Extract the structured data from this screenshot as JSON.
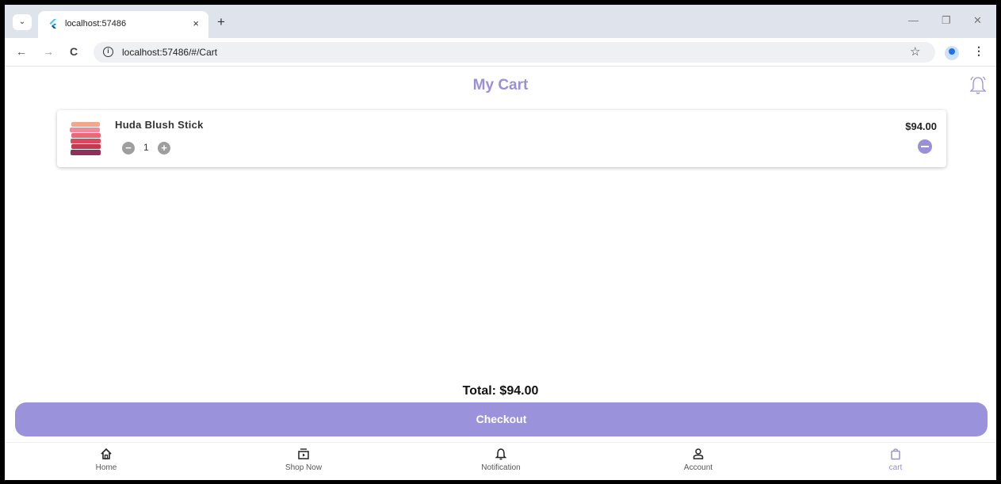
{
  "browser": {
    "tab_title": "localhost:57486",
    "tab_close": "×",
    "new_tab": "+",
    "url": "localhost:57486/#/Cart",
    "back": "←",
    "forward": "→",
    "reload": "C",
    "star": "☆",
    "menu": "⋮",
    "minimize": "—",
    "restore": "❐",
    "close": "✕",
    "tab_search": "⌄",
    "info": "i"
  },
  "page": {
    "title": "My Cart"
  },
  "cart": {
    "items": [
      {
        "name": "Huda Blush Stick",
        "quantity": "1",
        "price": "$94.00",
        "decrease": "−",
        "increase": "+"
      }
    ],
    "total": "Total: $94.00",
    "checkout_label": "Checkout"
  },
  "bottom_nav": {
    "items": [
      {
        "label": "Home",
        "icon": "home-icon"
      },
      {
        "label": "Shop Now",
        "icon": "shop-icon"
      },
      {
        "label": "Notification",
        "icon": "bell-icon"
      },
      {
        "label": "Account",
        "icon": "person-icon"
      },
      {
        "label": "cart",
        "icon": "bag-icon"
      }
    ],
    "active": "cart"
  },
  "colors": {
    "accent": "#9a90d8",
    "checkout": "#9a93db"
  }
}
